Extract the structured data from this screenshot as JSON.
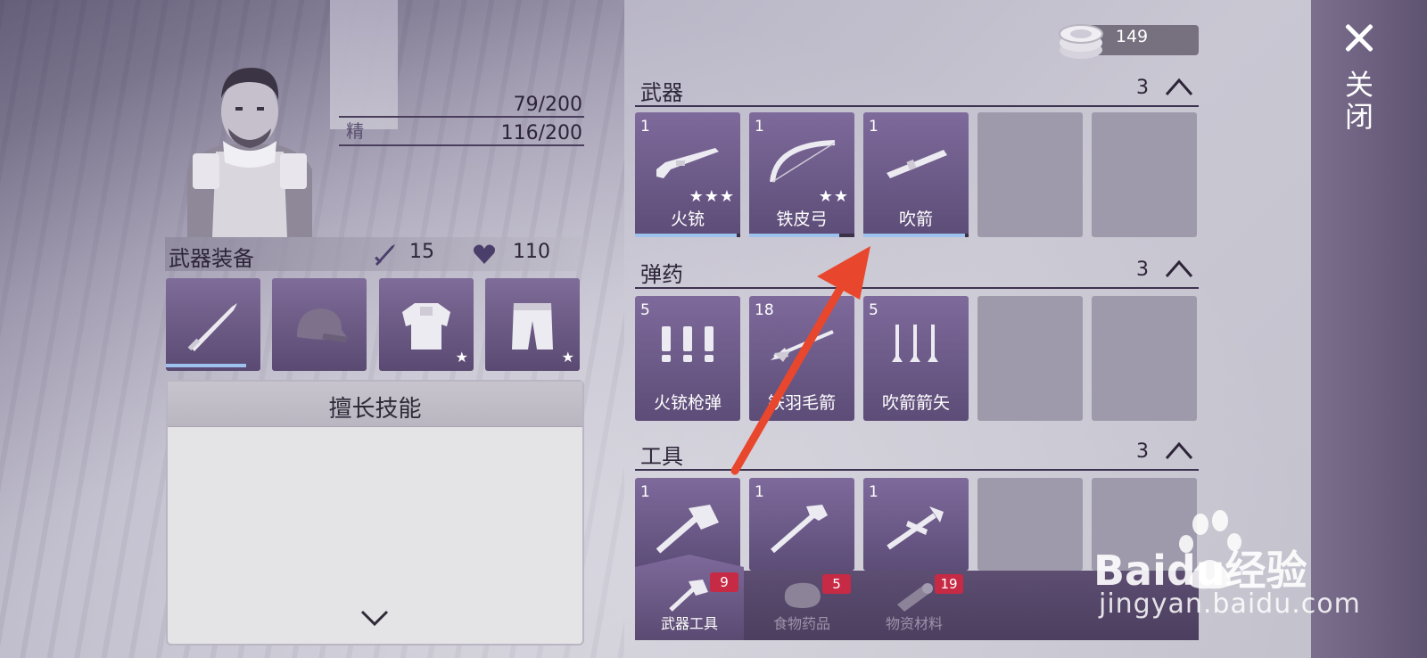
{
  "close": {
    "label": "关闭"
  },
  "character": {
    "stats": [
      {
        "label": "",
        "value": "79/200"
      },
      {
        "label": "精",
        "value": "116/200"
      }
    ]
  },
  "equipment": {
    "title": "武器装备",
    "attack": "15",
    "health": "110",
    "slots": [
      {
        "name": "blade",
        "durability": 0.85,
        "star": ""
      },
      {
        "name": "cap",
        "durability": 0,
        "star": ""
      },
      {
        "name": "armor",
        "durability": 0,
        "star": "★"
      },
      {
        "name": "pants",
        "durability": 0,
        "star": "★"
      }
    ]
  },
  "skills": {
    "title": "擅长技能"
  },
  "currency": {
    "amount": "149"
  },
  "categories": [
    {
      "title": "武器",
      "count": "3",
      "items": [
        {
          "qty": "1",
          "name": "火铳",
          "stars": "★★★",
          "durability": 0.97
        },
        {
          "qty": "1",
          "name": "铁皮弓",
          "stars": "★★",
          "durability": 0.86
        },
        {
          "qty": "1",
          "name": "吹箭",
          "stars": "",
          "durability": 0.97
        }
      ]
    },
    {
      "title": "弹药",
      "count": "3",
      "items": [
        {
          "qty": "5",
          "name": "火铳枪弹"
        },
        {
          "qty": "18",
          "name": "铁羽毛箭"
        },
        {
          "qty": "5",
          "name": "吹箭箭矢"
        }
      ]
    },
    {
      "title": "工具",
      "count": "3",
      "items": [
        {
          "qty": "1"
        },
        {
          "qty": "1"
        },
        {
          "qty": "1"
        }
      ]
    }
  ],
  "tabs": [
    {
      "label": "武器工具",
      "badge": "9",
      "active": true
    },
    {
      "label": "食物药品",
      "badge": "5",
      "active": false
    },
    {
      "label": "物资材料",
      "badge": "19",
      "active": false
    }
  ],
  "watermark": {
    "text": "jingyan.baidu.com",
    "brand": "Baidu经验"
  },
  "colors": {
    "accent": "#6e5b8a",
    "badge": "#c72a45",
    "durability": "#9ec2ee",
    "arrow": "#e8472d"
  }
}
